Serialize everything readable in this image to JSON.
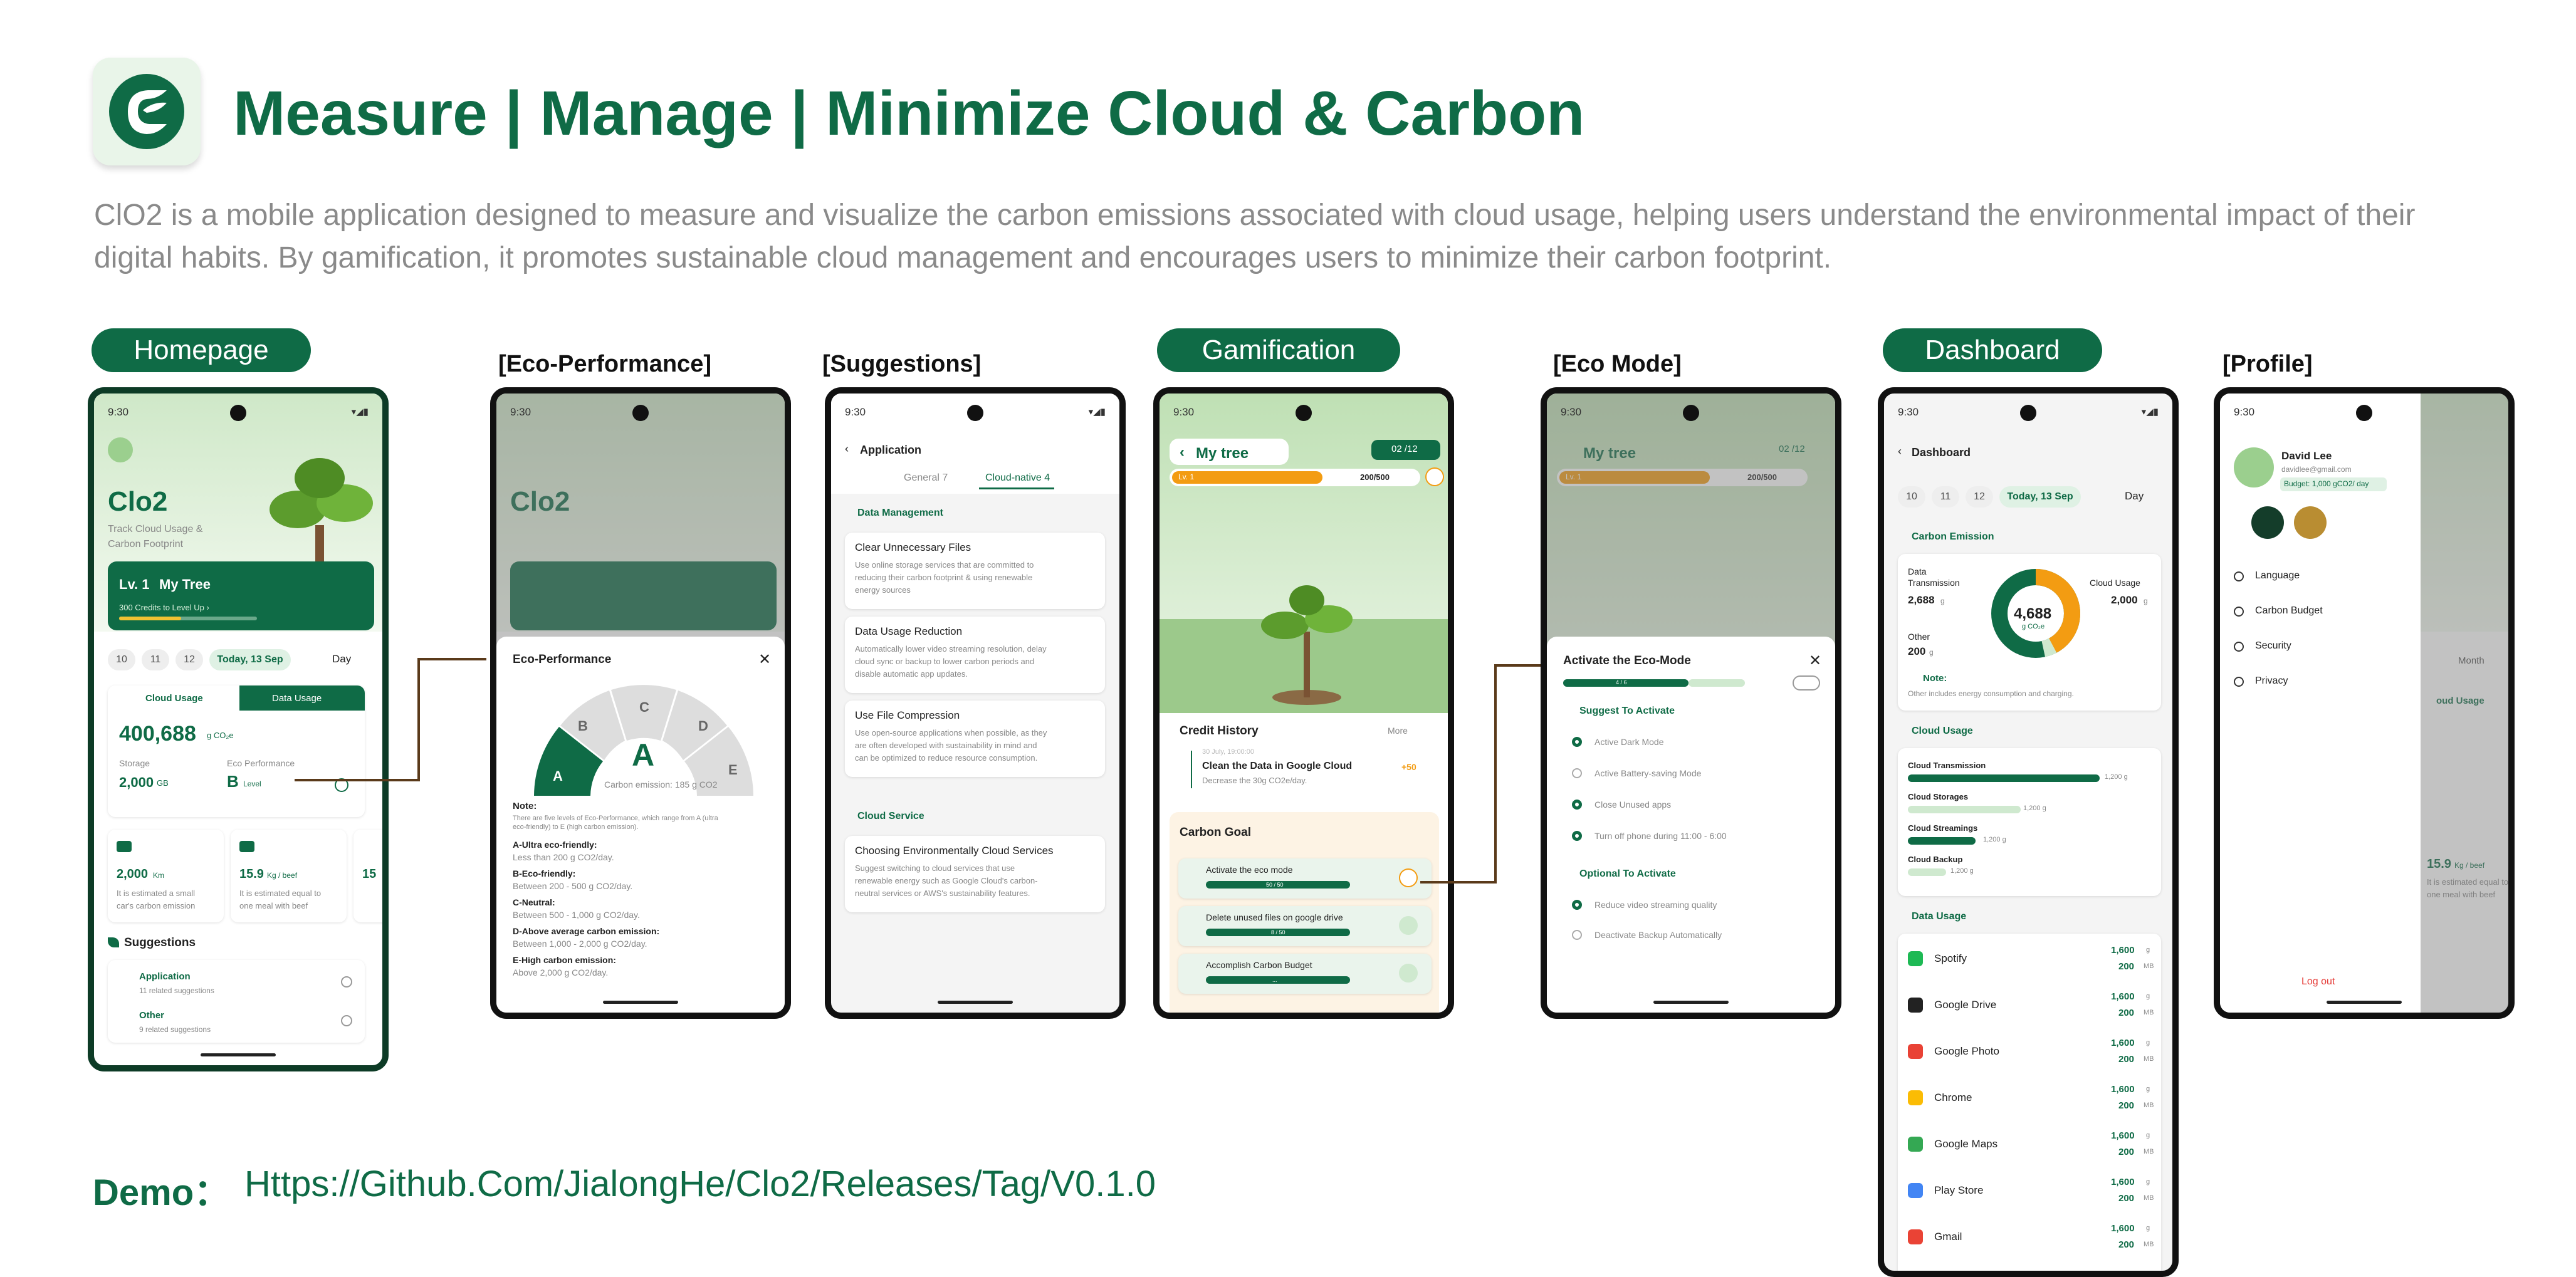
{
  "header": {
    "title": "Measure | Manage | Minimize Cloud & Carbon",
    "description": "ClO2 is a mobile application designed to measure and visualize the carbon emissions associated with cloud usage, helping users understand the environmental impact of their digital habits. By gamification, it promotes sustainable cloud management and encourages users to minimize their carbon footprint.",
    "demo_label": "Demo：",
    "demo_link": "Https://Github.Com/JialongHe/Clo2/Releases/Tag/V0.1.0"
  },
  "sections": {
    "homepage": "Homepage",
    "eco_performance": "[Eco-Performance]",
    "suggestions": "[Suggestions]",
    "gamification": "Gamification",
    "eco_mode": "[Eco Mode]",
    "dashboard": "Dashboard",
    "profile": "[Profile]"
  },
  "status": {
    "time": "9:30",
    "icons": "▾◢▮"
  },
  "home": {
    "brand": "Clo2",
    "tagline1": "Track Cloud Usage &",
    "tagline2": "Carbon Footprint",
    "level": "Lv. 1",
    "tree": "My Tree",
    "credits": "300 Credits to Level Up  ›",
    "dates": [
      "10",
      "11",
      "12",
      "Today, 13 Sep"
    ],
    "period": "Day",
    "tab_cloud": "Cloud Usage",
    "tab_data": "Data Usage",
    "big_value": "400,688",
    "big_unit": "g CO₂e",
    "storage_label": "Storage",
    "storage_value": "2,000",
    "storage_unit": "GB",
    "eco_label": "Eco Performance",
    "eco_grade": "B",
    "eco_level": "Level",
    "m1_value": "2,000",
    "m1_unit": "Km",
    "m1_text1": "It is estimated a small",
    "m1_text2": "car's carbon emission",
    "m2_value": "15.9",
    "m2_unit": "Kg / beef",
    "m2_text1": "It is estimated equal to",
    "m2_text2": "one meal with beef",
    "m3_value": "15",
    "suggestions_title": "Suggestions",
    "s1_title": "Application",
    "s1_sub": "11 related suggestions",
    "s2_title": "Other",
    "s2_sub": "9 related suggestions"
  },
  "eco": {
    "title": "Eco-Performance",
    "grades": [
      "A",
      "B",
      "C",
      "D",
      "E"
    ],
    "current": "A",
    "emission": "Carbon emission: 185 g CO2",
    "note_title": "Note:",
    "note_text1": "There are five levels of Eco-Performance, which range from A (ultra",
    "note_text2": "eco-friendly) to E (high carbon emission).",
    "levels": [
      {
        "name": "A-Ultra eco-friendly:",
        "range": "Less than 200 g CO2/day."
      },
      {
        "name": "B-Eco-friendly:",
        "range": "Between 200 - 500 g CO2/day."
      },
      {
        "name": "C-Neutral:",
        "range": "Between 500 - 1,000 g CO2/day."
      },
      {
        "name": "D-Above average carbon emission:",
        "range": "Between 1,000 - 2,000 g CO2/day."
      },
      {
        "name": "E-High carbon emission:",
        "range": "Above 2,000 g CO2/day."
      }
    ]
  },
  "sugg": {
    "back": "Application",
    "tab1": "General 7",
    "tab2": "Cloud-native 4",
    "sec1": "Data Management",
    "items1": [
      {
        "title": "Clear Unnecessary Files",
        "lines": [
          "Use online storage services that are committed to",
          "reducing their carbon footprint & using renewable",
          "energy sources"
        ]
      },
      {
        "title": "Data Usage Reduction",
        "lines": [
          "Automatically lower video streaming resolution, delay",
          "cloud sync or backup to lower carbon periods and",
          "disable automatic app updates."
        ]
      },
      {
        "title": "Use File Compression",
        "lines": [
          "Use open-source applications when possible, as they",
          "are often developed with sustainability in mind and",
          "can be optimized to reduce resource consumption."
        ]
      }
    ],
    "sec2": "Cloud Service",
    "items2": [
      {
        "title": "Choosing Environmentally Cloud Services",
        "lines": [
          "Suggest switching to cloud services that use",
          "renewable energy such as Google Cloud's carbon-",
          "neutral services or AWS's sustainability features."
        ]
      }
    ]
  },
  "game": {
    "title": "My tree",
    "counter": "02 /12",
    "level": "Lv. 1",
    "progress": "200/500",
    "credit_title": "Credit History",
    "more": "More",
    "history_date": "30 July, 19:00:00",
    "history_item": "Clean the Data in Google Cloud",
    "history_sub": "Decrease the 30g CO2e/day.",
    "history_points": "+50",
    "goal_title": "Carbon Goal",
    "goals": [
      {
        "label": "Activate the eco mode",
        "count": "50 / 50"
      },
      {
        "label": "Delete unused files on google drive",
        "count": "8 / 50"
      },
      {
        "label": "Accomplish Carbon Budget",
        "count": "..."
      }
    ]
  },
  "ecomode": {
    "title": "My tree",
    "counter": "02 /12",
    "level": "Lv. 1",
    "progress": "200/500",
    "sheet_title": "Activate the Eco-Mode",
    "steps": "4 / 6",
    "suggest_title": "Suggest To Activate",
    "suggest_items": [
      "Active Dark Mode",
      "Active Battery-saving Mode",
      "Close Unused apps",
      "Turn off phone during 11:00 - 6:00"
    ],
    "optional_title": "Optional To Activate",
    "optional_items": [
      "Reduce video streaming quality",
      "Deactivate Backup Automatically"
    ]
  },
  "dash": {
    "back": "Dashboard",
    "dates": [
      "10",
      "11",
      "12",
      "Today, 13 Sep"
    ],
    "period": "Day",
    "emission_title": "Carbon Emission",
    "dt_label1": "Data",
    "dt_label2": "Transmission",
    "dt_value": "2,688",
    "cloud_label": "Cloud Usage",
    "cloud_value": "2,000",
    "other_label": "Other",
    "other_value": "200",
    "unit_g": "g",
    "center_value": "4,688",
    "center_unit": "g CO₂e",
    "note_title": "Note:",
    "note_text": "Other includes energy consumption and charging.",
    "cloud_title": "Cloud Usage",
    "cloud_rows": [
      {
        "label": "Cloud Transmission",
        "value": "1,200 g",
        "fill": 0.85
      },
      {
        "label": "Cloud Storages",
        "value": "1,200 g",
        "fill": 0.5
      },
      {
        "label": "Cloud Streamings",
        "value": "1,200 g",
        "fill": 0.3
      },
      {
        "label": "Cloud Backup",
        "value": "1,200 g",
        "fill": 0.17
      }
    ],
    "data_title": "Data Usage",
    "apps": [
      {
        "name": "Spotify",
        "g": "1,600",
        "mb": "200",
        "color": "#1db954"
      },
      {
        "name": "Google Drive",
        "g": "1,600",
        "mb": "200",
        "color": "#222"
      },
      {
        "name": "Google Photo",
        "g": "1,600",
        "mb": "200",
        "color": "#e94235"
      },
      {
        "name": "Chrome",
        "g": "1,600",
        "mb": "200",
        "color": "#fbbc04"
      },
      {
        "name": "Google Maps",
        "g": "1,600",
        "mb": "200",
        "color": "#34a853"
      },
      {
        "name": "Play Store",
        "g": "1,600",
        "mb": "200",
        "color": "#4285f4"
      },
      {
        "name": "Gmail",
        "g": "1,600",
        "mb": "200",
        "color": "#ea4335"
      }
    ],
    "unit_g2": "g",
    "unit_mb": "MB"
  },
  "profile": {
    "name": "David Lee",
    "email": "davidlee@gmail.com",
    "budget": "Budget: 1,000 gCO2/ day",
    "menu": [
      "Language",
      "Carbon Budget",
      "Security",
      "Privacy"
    ],
    "logout": "Log out",
    "bg_month": "Month",
    "bg_cloud": "oud Usage",
    "bg_value": "15.9",
    "bg_unit": "Kg / beef",
    "bg_text1": "It is estimated equal to",
    "bg_text2": "one meal with beef"
  }
}
